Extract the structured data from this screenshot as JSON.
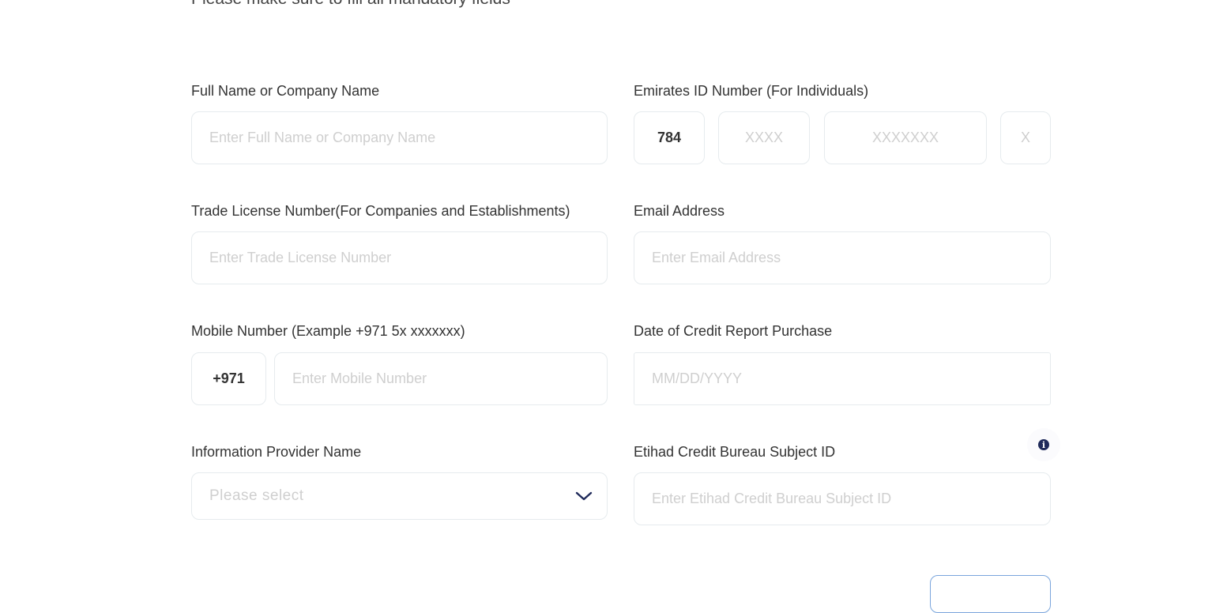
{
  "form": {
    "intro": "Please make sure to fill all mandatory fields",
    "full_name": {
      "label": "Full Name or Company Name",
      "placeholder": "Enter Full Name or Company Name",
      "value": ""
    },
    "emirates_id": {
      "label": "Emirates ID Number (For Individuals)",
      "prefix": "784",
      "segments": [
        {
          "placeholder": "XXXX",
          "value": ""
        },
        {
          "placeholder": "XXXXXXX",
          "value": ""
        },
        {
          "placeholder": "X",
          "value": ""
        }
      ]
    },
    "trade_license": {
      "label": "Trade License Number(For Companies and Establishments)",
      "placeholder": "Enter Trade License Number",
      "value": ""
    },
    "email": {
      "label": "Email Address",
      "placeholder": "Enter Email Address",
      "value": ""
    },
    "mobile": {
      "label": "Mobile Number (Example +971 5x xxxxxxx)",
      "country_code": "+971",
      "placeholder": "Enter Mobile Number",
      "value": ""
    },
    "purchase_date": {
      "label": "Date of Credit Report Purchase",
      "placeholder": "MM/DD/YYYY",
      "value": ""
    },
    "provider": {
      "label": "Information Provider Name",
      "selected": "Please select"
    },
    "subject_id": {
      "label": "Etihad Credit Bureau Subject ID",
      "placeholder": "Enter Etihad Credit Bureau Subject ID",
      "value": "",
      "info_icon": "info-icon"
    }
  },
  "colors": {
    "accent": "#1f2a5a",
    "button_border": "#7aa5dc",
    "field_border": "#e6ebee",
    "placeholder": "#cfcfcf"
  }
}
